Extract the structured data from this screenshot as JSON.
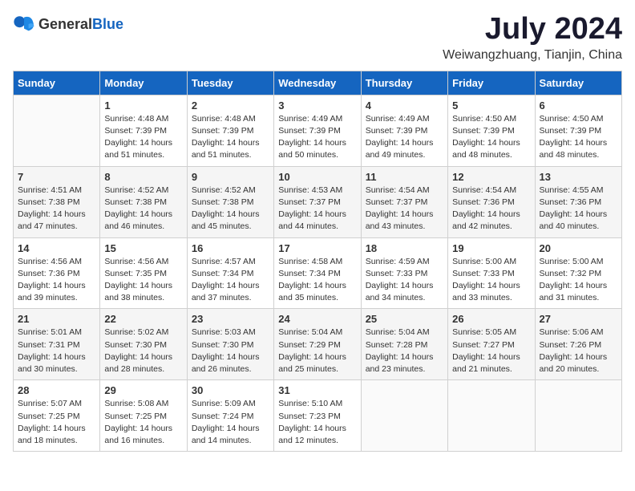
{
  "header": {
    "logo_general": "General",
    "logo_blue": "Blue",
    "title": "July 2024",
    "subtitle": "Weiwangzhuang, Tianjin, China"
  },
  "weekdays": [
    "Sunday",
    "Monday",
    "Tuesday",
    "Wednesday",
    "Thursday",
    "Friday",
    "Saturday"
  ],
  "weeks": [
    [
      {
        "day": "",
        "sunrise": "",
        "sunset": "",
        "daylight": ""
      },
      {
        "day": "1",
        "sunrise": "Sunrise: 4:48 AM",
        "sunset": "Sunset: 7:39 PM",
        "daylight": "Daylight: 14 hours and 51 minutes."
      },
      {
        "day": "2",
        "sunrise": "Sunrise: 4:48 AM",
        "sunset": "Sunset: 7:39 PM",
        "daylight": "Daylight: 14 hours and 51 minutes."
      },
      {
        "day": "3",
        "sunrise": "Sunrise: 4:49 AM",
        "sunset": "Sunset: 7:39 PM",
        "daylight": "Daylight: 14 hours and 50 minutes."
      },
      {
        "day": "4",
        "sunrise": "Sunrise: 4:49 AM",
        "sunset": "Sunset: 7:39 PM",
        "daylight": "Daylight: 14 hours and 49 minutes."
      },
      {
        "day": "5",
        "sunrise": "Sunrise: 4:50 AM",
        "sunset": "Sunset: 7:39 PM",
        "daylight": "Daylight: 14 hours and 48 minutes."
      },
      {
        "day": "6",
        "sunrise": "Sunrise: 4:50 AM",
        "sunset": "Sunset: 7:39 PM",
        "daylight": "Daylight: 14 hours and 48 minutes."
      }
    ],
    [
      {
        "day": "7",
        "sunrise": "Sunrise: 4:51 AM",
        "sunset": "Sunset: 7:38 PM",
        "daylight": "Daylight: 14 hours and 47 minutes."
      },
      {
        "day": "8",
        "sunrise": "Sunrise: 4:52 AM",
        "sunset": "Sunset: 7:38 PM",
        "daylight": "Daylight: 14 hours and 46 minutes."
      },
      {
        "day": "9",
        "sunrise": "Sunrise: 4:52 AM",
        "sunset": "Sunset: 7:38 PM",
        "daylight": "Daylight: 14 hours and 45 minutes."
      },
      {
        "day": "10",
        "sunrise": "Sunrise: 4:53 AM",
        "sunset": "Sunset: 7:37 PM",
        "daylight": "Daylight: 14 hours and 44 minutes."
      },
      {
        "day": "11",
        "sunrise": "Sunrise: 4:54 AM",
        "sunset": "Sunset: 7:37 PM",
        "daylight": "Daylight: 14 hours and 43 minutes."
      },
      {
        "day": "12",
        "sunrise": "Sunrise: 4:54 AM",
        "sunset": "Sunset: 7:36 PM",
        "daylight": "Daylight: 14 hours and 42 minutes."
      },
      {
        "day": "13",
        "sunrise": "Sunrise: 4:55 AM",
        "sunset": "Sunset: 7:36 PM",
        "daylight": "Daylight: 14 hours and 40 minutes."
      }
    ],
    [
      {
        "day": "14",
        "sunrise": "Sunrise: 4:56 AM",
        "sunset": "Sunset: 7:36 PM",
        "daylight": "Daylight: 14 hours and 39 minutes."
      },
      {
        "day": "15",
        "sunrise": "Sunrise: 4:56 AM",
        "sunset": "Sunset: 7:35 PM",
        "daylight": "Daylight: 14 hours and 38 minutes."
      },
      {
        "day": "16",
        "sunrise": "Sunrise: 4:57 AM",
        "sunset": "Sunset: 7:34 PM",
        "daylight": "Daylight: 14 hours and 37 minutes."
      },
      {
        "day": "17",
        "sunrise": "Sunrise: 4:58 AM",
        "sunset": "Sunset: 7:34 PM",
        "daylight": "Daylight: 14 hours and 35 minutes."
      },
      {
        "day": "18",
        "sunrise": "Sunrise: 4:59 AM",
        "sunset": "Sunset: 7:33 PM",
        "daylight": "Daylight: 14 hours and 34 minutes."
      },
      {
        "day": "19",
        "sunrise": "Sunrise: 5:00 AM",
        "sunset": "Sunset: 7:33 PM",
        "daylight": "Daylight: 14 hours and 33 minutes."
      },
      {
        "day": "20",
        "sunrise": "Sunrise: 5:00 AM",
        "sunset": "Sunset: 7:32 PM",
        "daylight": "Daylight: 14 hours and 31 minutes."
      }
    ],
    [
      {
        "day": "21",
        "sunrise": "Sunrise: 5:01 AM",
        "sunset": "Sunset: 7:31 PM",
        "daylight": "Daylight: 14 hours and 30 minutes."
      },
      {
        "day": "22",
        "sunrise": "Sunrise: 5:02 AM",
        "sunset": "Sunset: 7:30 PM",
        "daylight": "Daylight: 14 hours and 28 minutes."
      },
      {
        "day": "23",
        "sunrise": "Sunrise: 5:03 AM",
        "sunset": "Sunset: 7:30 PM",
        "daylight": "Daylight: 14 hours and 26 minutes."
      },
      {
        "day": "24",
        "sunrise": "Sunrise: 5:04 AM",
        "sunset": "Sunset: 7:29 PM",
        "daylight": "Daylight: 14 hours and 25 minutes."
      },
      {
        "day": "25",
        "sunrise": "Sunrise: 5:04 AM",
        "sunset": "Sunset: 7:28 PM",
        "daylight": "Daylight: 14 hours and 23 minutes."
      },
      {
        "day": "26",
        "sunrise": "Sunrise: 5:05 AM",
        "sunset": "Sunset: 7:27 PM",
        "daylight": "Daylight: 14 hours and 21 minutes."
      },
      {
        "day": "27",
        "sunrise": "Sunrise: 5:06 AM",
        "sunset": "Sunset: 7:26 PM",
        "daylight": "Daylight: 14 hours and 20 minutes."
      }
    ],
    [
      {
        "day": "28",
        "sunrise": "Sunrise: 5:07 AM",
        "sunset": "Sunset: 7:25 PM",
        "daylight": "Daylight: 14 hours and 18 minutes."
      },
      {
        "day": "29",
        "sunrise": "Sunrise: 5:08 AM",
        "sunset": "Sunset: 7:25 PM",
        "daylight": "Daylight: 14 hours and 16 minutes."
      },
      {
        "day": "30",
        "sunrise": "Sunrise: 5:09 AM",
        "sunset": "Sunset: 7:24 PM",
        "daylight": "Daylight: 14 hours and 14 minutes."
      },
      {
        "day": "31",
        "sunrise": "Sunrise: 5:10 AM",
        "sunset": "Sunset: 7:23 PM",
        "daylight": "Daylight: 14 hours and 12 minutes."
      },
      {
        "day": "",
        "sunrise": "",
        "sunset": "",
        "daylight": ""
      },
      {
        "day": "",
        "sunrise": "",
        "sunset": "",
        "daylight": ""
      },
      {
        "day": "",
        "sunrise": "",
        "sunset": "",
        "daylight": ""
      }
    ]
  ]
}
